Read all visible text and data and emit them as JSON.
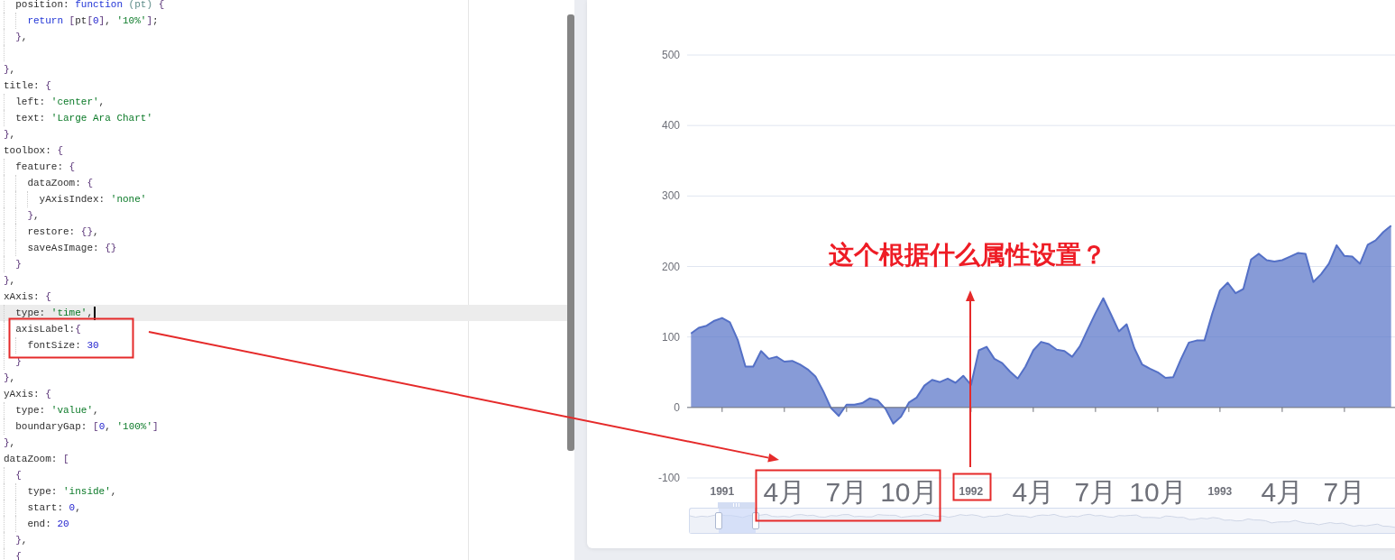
{
  "code_editor": {
    "lines": [
      {
        "kind": "code",
        "current": false,
        "tokens": [
          {
            "kind": "key",
            "text": "  position"
          },
          {
            "kind": "punct",
            "text": ": "
          },
          {
            "kind": "keyword",
            "text": "function"
          },
          {
            "kind": "param",
            "text": " (pt) "
          },
          {
            "kind": "brace",
            "text": "{"
          }
        ]
      },
      {
        "kind": "code",
        "current": false,
        "tokens": [
          {
            "kind": "keyword",
            "text": "    return"
          },
          {
            "kind": "brace",
            "text": " ["
          },
          {
            "kind": "punct",
            "text": "pt"
          },
          {
            "kind": "brace",
            "text": "["
          },
          {
            "kind": "number",
            "text": "0"
          },
          {
            "kind": "brace",
            "text": "]"
          },
          {
            "kind": "punct",
            "text": ", "
          },
          {
            "kind": "string",
            "text": "'10%'"
          },
          {
            "kind": "brace",
            "text": "]"
          },
          {
            "kind": "punct",
            "text": ";"
          }
        ]
      },
      {
        "kind": "code",
        "current": false,
        "tokens": [
          {
            "kind": "brace",
            "text": "  }"
          },
          {
            "kind": "punct",
            "text": ","
          }
        ]
      },
      {
        "kind": "blank",
        "current": false
      },
      {
        "kind": "code",
        "current": false,
        "tokens": [
          {
            "kind": "brace",
            "text": "}"
          },
          {
            "kind": "punct",
            "text": ","
          }
        ]
      },
      {
        "kind": "code",
        "current": false,
        "tokens": [
          {
            "kind": "key",
            "text": "title"
          },
          {
            "kind": "punct",
            "text": ": "
          },
          {
            "kind": "brace",
            "text": "{"
          }
        ]
      },
      {
        "kind": "code",
        "current": false,
        "tokens": [
          {
            "kind": "key",
            "text": "  left"
          },
          {
            "kind": "punct",
            "text": ": "
          },
          {
            "kind": "string",
            "text": "'center'"
          },
          {
            "kind": "punct",
            "text": ","
          }
        ]
      },
      {
        "kind": "code",
        "current": false,
        "tokens": [
          {
            "kind": "key",
            "text": "  text"
          },
          {
            "kind": "punct",
            "text": ": "
          },
          {
            "kind": "string",
            "text": "'Large Ara Chart'"
          }
        ]
      },
      {
        "kind": "code",
        "current": false,
        "tokens": [
          {
            "kind": "brace",
            "text": "}"
          },
          {
            "kind": "punct",
            "text": ","
          }
        ]
      },
      {
        "kind": "code",
        "current": false,
        "tokens": [
          {
            "kind": "key",
            "text": "toolbox"
          },
          {
            "kind": "punct",
            "text": ": "
          },
          {
            "kind": "brace",
            "text": "{"
          }
        ]
      },
      {
        "kind": "code",
        "current": false,
        "tokens": [
          {
            "kind": "key",
            "text": "  feature"
          },
          {
            "kind": "punct",
            "text": ": "
          },
          {
            "kind": "brace",
            "text": "{"
          }
        ]
      },
      {
        "kind": "code",
        "current": false,
        "tokens": [
          {
            "kind": "key",
            "text": "    dataZoom"
          },
          {
            "kind": "punct",
            "text": ": "
          },
          {
            "kind": "brace",
            "text": "{"
          }
        ]
      },
      {
        "kind": "code",
        "current": false,
        "tokens": [
          {
            "kind": "key",
            "text": "      yAxisIndex"
          },
          {
            "kind": "punct",
            "text": ": "
          },
          {
            "kind": "string",
            "text": "'none'"
          }
        ]
      },
      {
        "kind": "code",
        "current": false,
        "tokens": [
          {
            "kind": "brace",
            "text": "    }"
          },
          {
            "kind": "punct",
            "text": ","
          }
        ]
      },
      {
        "kind": "code",
        "current": false,
        "tokens": [
          {
            "kind": "key",
            "text": "    restore"
          },
          {
            "kind": "punct",
            "text": ": "
          },
          {
            "kind": "brace",
            "text": "{}"
          },
          {
            "kind": "punct",
            "text": ","
          }
        ]
      },
      {
        "kind": "code",
        "current": false,
        "tokens": [
          {
            "kind": "key",
            "text": "    saveAsImage"
          },
          {
            "kind": "punct",
            "text": ": "
          },
          {
            "kind": "brace",
            "text": "{}"
          }
        ]
      },
      {
        "kind": "code",
        "current": false,
        "tokens": [
          {
            "kind": "brace",
            "text": "  }"
          }
        ]
      },
      {
        "kind": "code",
        "current": false,
        "tokens": [
          {
            "kind": "brace",
            "text": "}"
          },
          {
            "kind": "punct",
            "text": ","
          }
        ]
      },
      {
        "kind": "code",
        "current": false,
        "tokens": [
          {
            "kind": "key",
            "text": "xAxis"
          },
          {
            "kind": "punct",
            "text": ": "
          },
          {
            "kind": "brace",
            "text": "{"
          }
        ]
      },
      {
        "kind": "code",
        "current": true,
        "tokens": [
          {
            "kind": "key",
            "text": "  type"
          },
          {
            "kind": "punct",
            "text": ": "
          },
          {
            "kind": "string",
            "text": "'time'"
          },
          {
            "kind": "punct",
            "text": ","
          }
        ]
      },
      {
        "kind": "code",
        "current": false,
        "tokens": [
          {
            "kind": "key",
            "text": "  axisLabel"
          },
          {
            "kind": "punct",
            "text": ":"
          },
          {
            "kind": "brace",
            "text": "{"
          }
        ]
      },
      {
        "kind": "code",
        "current": false,
        "tokens": [
          {
            "kind": "key",
            "text": "    fontSize"
          },
          {
            "kind": "punct",
            "text": ": "
          },
          {
            "kind": "number",
            "text": "30"
          }
        ]
      },
      {
        "kind": "code",
        "current": false,
        "tokens": [
          {
            "kind": "brace",
            "text": "  }"
          }
        ]
      },
      {
        "kind": "code",
        "current": false,
        "tokens": [
          {
            "kind": "brace",
            "text": "}"
          },
          {
            "kind": "punct",
            "text": ","
          }
        ]
      },
      {
        "kind": "code",
        "current": false,
        "tokens": [
          {
            "kind": "key",
            "text": "yAxis"
          },
          {
            "kind": "punct",
            "text": ": "
          },
          {
            "kind": "brace",
            "text": "{"
          }
        ]
      },
      {
        "kind": "code",
        "current": false,
        "tokens": [
          {
            "kind": "key",
            "text": "  type"
          },
          {
            "kind": "punct",
            "text": ": "
          },
          {
            "kind": "string",
            "text": "'value'"
          },
          {
            "kind": "punct",
            "text": ","
          }
        ]
      },
      {
        "kind": "code",
        "current": false,
        "tokens": [
          {
            "kind": "key",
            "text": "  boundaryGap"
          },
          {
            "kind": "punct",
            "text": ": "
          },
          {
            "kind": "brace",
            "text": "["
          },
          {
            "kind": "number",
            "text": "0"
          },
          {
            "kind": "punct",
            "text": ", "
          },
          {
            "kind": "string",
            "text": "'100%'"
          },
          {
            "kind": "brace",
            "text": "]"
          }
        ]
      },
      {
        "kind": "code",
        "current": false,
        "tokens": [
          {
            "kind": "brace",
            "text": "}"
          },
          {
            "kind": "punct",
            "text": ","
          }
        ]
      },
      {
        "kind": "code",
        "current": false,
        "tokens": [
          {
            "kind": "key",
            "text": "dataZoom"
          },
          {
            "kind": "punct",
            "text": ": "
          },
          {
            "kind": "brace",
            "text": "["
          }
        ]
      },
      {
        "kind": "code",
        "current": false,
        "tokens": [
          {
            "kind": "brace",
            "text": "  {"
          }
        ]
      },
      {
        "kind": "code",
        "current": false,
        "tokens": [
          {
            "kind": "key",
            "text": "    type"
          },
          {
            "kind": "punct",
            "text": ": "
          },
          {
            "kind": "string",
            "text": "'inside'"
          },
          {
            "kind": "punct",
            "text": ","
          }
        ]
      },
      {
        "kind": "code",
        "current": false,
        "tokens": [
          {
            "kind": "key",
            "text": "    start"
          },
          {
            "kind": "punct",
            "text": ": "
          },
          {
            "kind": "number",
            "text": "0"
          },
          {
            "kind": "punct",
            "text": ","
          }
        ]
      },
      {
        "kind": "code",
        "current": false,
        "tokens": [
          {
            "kind": "key",
            "text": "    end"
          },
          {
            "kind": "punct",
            "text": ": "
          },
          {
            "kind": "number",
            "text": "20"
          }
        ]
      },
      {
        "kind": "code",
        "current": false,
        "tokens": [
          {
            "kind": "brace",
            "text": "  }"
          },
          {
            "kind": "punct",
            "text": ","
          }
        ]
      },
      {
        "kind": "code",
        "current": false,
        "tokens": [
          {
            "kind": "brace",
            "text": "  {"
          }
        ]
      }
    ]
  },
  "chart": {
    "chart_data": {
      "type": "area",
      "grid": true,
      "ylim": [
        -100,
        500
      ],
      "yticks": [
        -100,
        0,
        100,
        200,
        300,
        400,
        500
      ],
      "categories": [
        null,
        null,
        null,
        null,
        "1991",
        null,
        null,
        null,
        null,
        null,
        null,
        null,
        "4月",
        null,
        null,
        null,
        null,
        null,
        null,
        null,
        "7月",
        null,
        null,
        null,
        null,
        null,
        null,
        null,
        "10月",
        null,
        null,
        null,
        null,
        null,
        null,
        null,
        "1992",
        null,
        null,
        null,
        null,
        null,
        null,
        null,
        "4月",
        null,
        null,
        null,
        null,
        null,
        null,
        null,
        "7月",
        null,
        null,
        null,
        null,
        null,
        null,
        null,
        "10月",
        null,
        null,
        null,
        null,
        null,
        null,
        null,
        "1993",
        null,
        null,
        null,
        null,
        null,
        null,
        null,
        "4月",
        null,
        null,
        null,
        null,
        null,
        null,
        null,
        "7月",
        null,
        null,
        null,
        null,
        null,
        null
      ],
      "series": [
        {
          "color": "#5470c6",
          "values": [
            105,
            113,
            116,
            123,
            127,
            121,
            96,
            58,
            58,
            80,
            69,
            72,
            65,
            66,
            61,
            54,
            44,
            23,
            -1,
            -12,
            4,
            4,
            6,
            13,
            10,
            -2,
            -23,
            -13,
            7,
            14,
            31,
            39,
            36,
            41,
            35,
            45,
            32,
            81,
            86,
            69,
            63,
            51,
            41,
            58,
            81,
            93,
            90,
            82,
            80,
            72,
            87,
            111,
            134,
            155,
            132,
            108,
            118,
            84,
            61,
            55,
            50,
            42,
            43,
            69,
            92,
            95,
            95,
            133,
            166,
            177,
            162,
            168,
            210,
            218,
            209,
            207,
            209,
            214,
            219,
            218,
            178,
            189,
            204,
            230,
            215,
            214,
            204,
            231,
            237,
            249,
            258
          ]
        }
      ]
    }
  },
  "callout": {
    "text": "这个根据什么属性设置？"
  }
}
